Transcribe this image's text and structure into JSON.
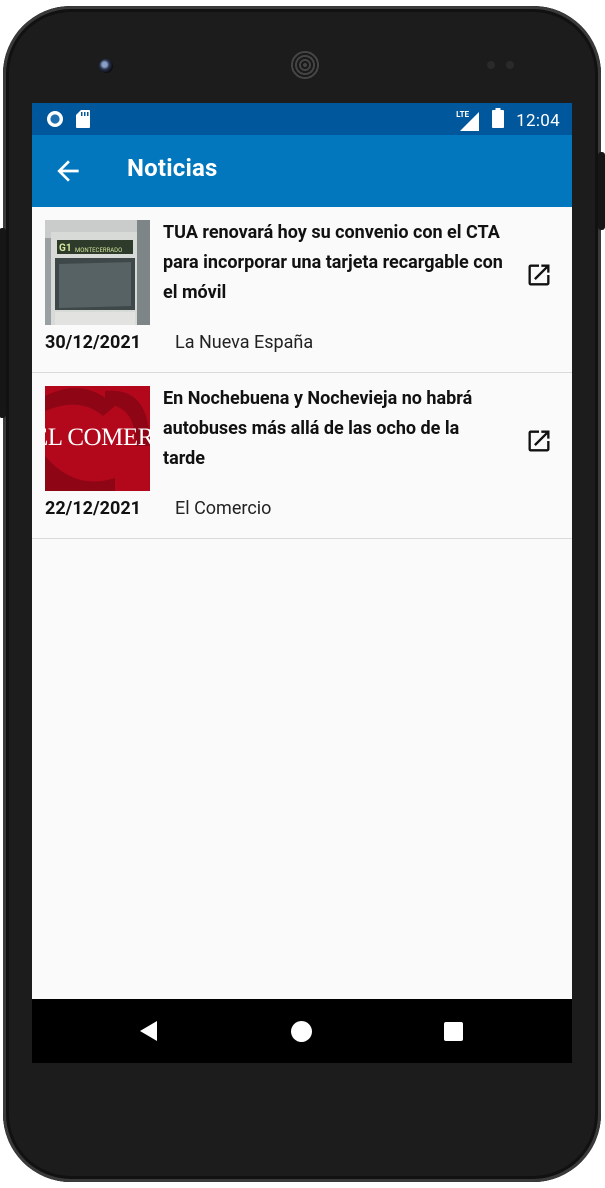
{
  "status_bar": {
    "network": "LTE",
    "time": "12:04"
  },
  "app_bar": {
    "title": "Noticias"
  },
  "news": [
    {
      "headline": "TUA renovará hoy su convenio con el CTA para incorporar una tarjeta recargable con el móvil",
      "date": "30/12/2021",
      "source": "La Nueva España",
      "thumb_sign_line1": "G1",
      "thumb_sign_line2": "MONTECERRADO"
    },
    {
      "headline": "En Nochebuena y Nochevieja no habrá autobuses más allá de las ocho de la tarde",
      "date": "22/12/2021",
      "source": "El Comercio",
      "logo_text": "EL COMERCIO"
    }
  ],
  "colors": {
    "status_bar": "#01579b",
    "app_bar": "#0277bd",
    "logo_red": "#b3081b"
  },
  "icons": [
    "circle-notification-icon",
    "sd-card-icon",
    "lte-signal-icon",
    "battery-icon",
    "arrow-back-icon",
    "open-in-new-icon",
    "nav-back-icon",
    "nav-home-icon",
    "nav-recents-icon"
  ]
}
